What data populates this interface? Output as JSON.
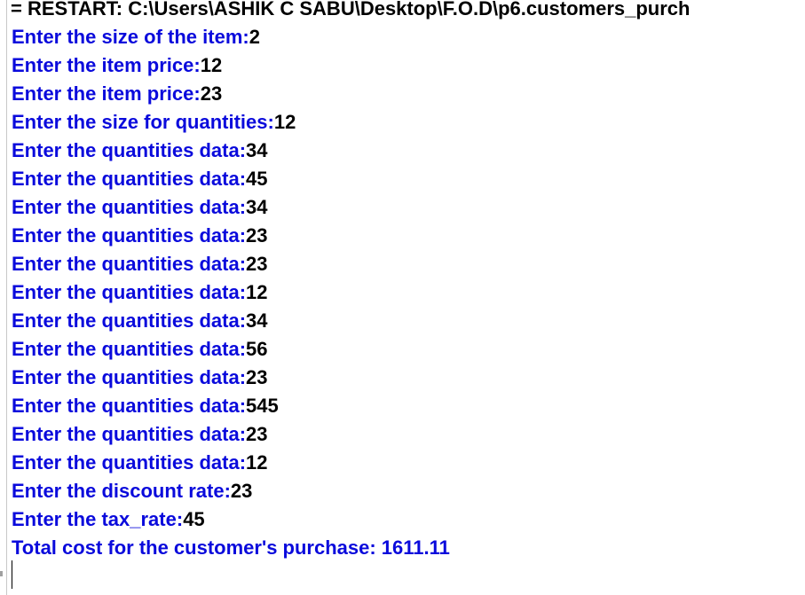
{
  "shell": {
    "restart_line": "= RESTART: C:\\Users\\ASHIK C SABU\\Desktop\\F.O.D\\p6.customers_purch",
    "lines": [
      {
        "prompt": "Enter the size of the item:",
        "value": "2"
      },
      {
        "prompt": "Enter the item price:",
        "value": "12"
      },
      {
        "prompt": "Enter the item price:",
        "value": "23"
      },
      {
        "prompt": "Enter the size for quantities:",
        "value": "12"
      },
      {
        "prompt": "Enter the quantities data:",
        "value": "34"
      },
      {
        "prompt": "Enter the quantities data:",
        "value": "45"
      },
      {
        "prompt": "Enter the quantities data:",
        "value": "34"
      },
      {
        "prompt": "Enter the quantities data:",
        "value": "23"
      },
      {
        "prompt": "Enter the quantities data:",
        "value": "23"
      },
      {
        "prompt": "Enter the quantities data:",
        "value": "12"
      },
      {
        "prompt": "Enter the quantities data:",
        "value": "34"
      },
      {
        "prompt": "Enter the quantities data:",
        "value": "56"
      },
      {
        "prompt": "Enter the quantities data:",
        "value": "23"
      },
      {
        "prompt": "Enter the quantities data:",
        "value": "545"
      },
      {
        "prompt": "Enter the quantities data:",
        "value": "23"
      },
      {
        "prompt": "Enter the quantities data:",
        "value": "12"
      },
      {
        "prompt": "Enter the discount rate:",
        "value": "23"
      },
      {
        "prompt": "Enter the tax_rate:",
        "value": "45"
      }
    ],
    "result_line": "Total cost for the customer's purchase: 1611.11"
  },
  "colors": {
    "prompt": "#0a0adc",
    "value": "#000000",
    "background": "#ffffff"
  }
}
